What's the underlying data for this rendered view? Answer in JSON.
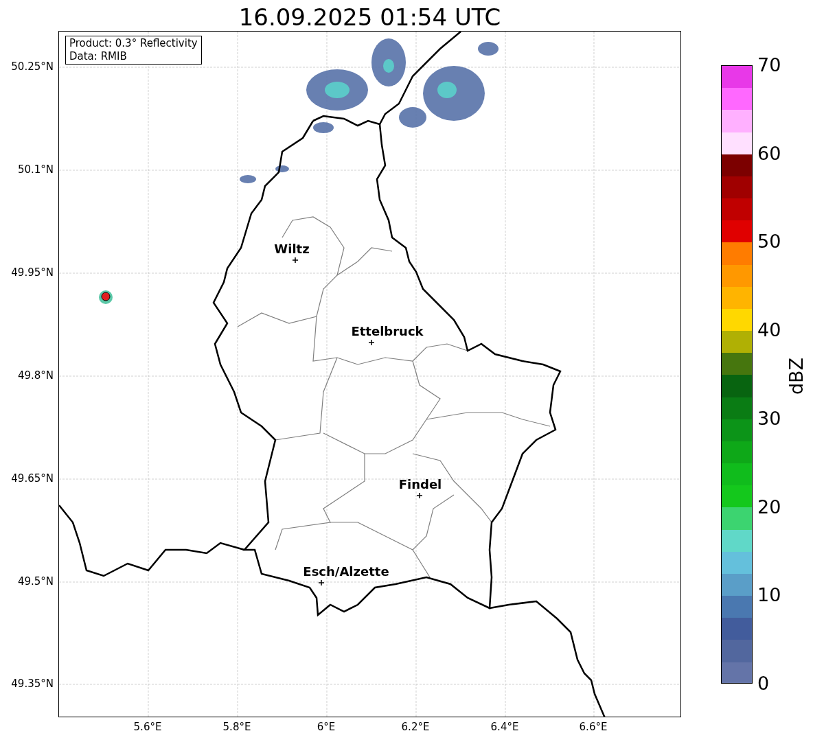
{
  "title": "16.09.2025 01:54 UTC",
  "info_box": [
    "Product: 0.3° Reflectivity",
    "Data: RMIB"
  ],
  "y_ticks": [
    "50.25°N",
    "50.1°N",
    "49.95°N",
    "49.8°N",
    "49.65°N",
    "49.5°N",
    "49.35°N"
  ],
  "x_ticks": [
    "5.6°E",
    "5.8°E",
    "6°E",
    "6.2°E",
    "6.4°E",
    "6.6°E"
  ],
  "cities": [
    {
      "name": "Wiltz"
    },
    {
      "name": "Ettelbruck"
    },
    {
      "name": "Findel"
    },
    {
      "name": "Esch/Alzette"
    }
  ],
  "colorbar": {
    "label": "dBZ",
    "ticks": [
      "70",
      "60",
      "50",
      "40",
      "30",
      "20",
      "10",
      "0"
    ],
    "segments": [
      {
        "color": "#e838e8"
      },
      {
        "color": "#ff68ff"
      },
      {
        "color": "#ffb0ff"
      },
      {
        "color": "#ffe0ff"
      },
      {
        "color": "#7c0000"
      },
      {
        "color": "#a00000"
      },
      {
        "color": "#c00000"
      },
      {
        "color": "#e00000"
      },
      {
        "color": "#ff7c00"
      },
      {
        "color": "#ff9800"
      },
      {
        "color": "#ffb400"
      },
      {
        "color": "#ffd800"
      },
      {
        "color": "#b0b004"
      },
      {
        "color": "#46760e"
      },
      {
        "color": "#086410"
      },
      {
        "color": "#0a7c14"
      },
      {
        "color": "#0c9418"
      },
      {
        "color": "#0ea818"
      },
      {
        "color": "#10bc1c"
      },
      {
        "color": "#14c81c"
      },
      {
        "color": "#3cd470"
      },
      {
        "color": "#60d8c8"
      },
      {
        "color": "#64c0dc"
      },
      {
        "color": "#5a9ec8"
      },
      {
        "color": "#4a78b0"
      },
      {
        "color": "#425c9c"
      },
      {
        "color": "#52679e"
      },
      {
        "color": "#6474a8"
      }
    ]
  }
}
